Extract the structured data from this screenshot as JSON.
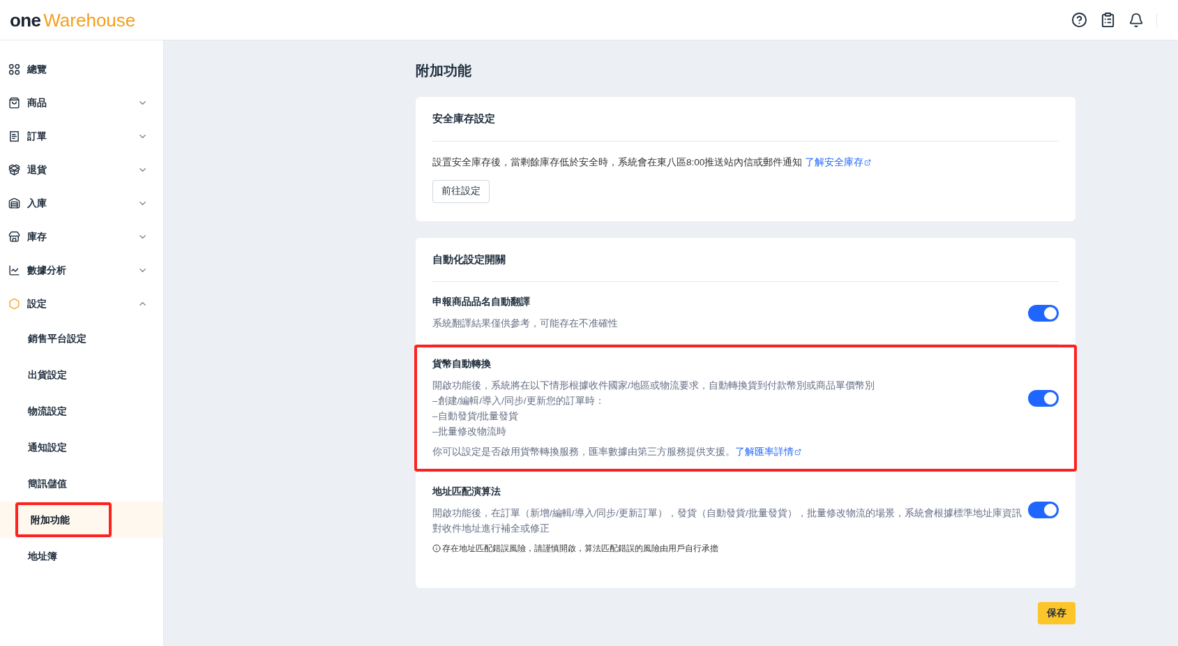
{
  "header": {
    "logo_main": "one",
    "logo_accent": "Warehouse"
  },
  "sidebar": {
    "items": [
      {
        "label": "總覽",
        "kind": "overview",
        "selected": false
      },
      {
        "label": "商品",
        "kind": "bag",
        "selected": false,
        "expanded": false
      },
      {
        "label": "訂單",
        "kind": "receipt",
        "selected": false,
        "expanded": false
      },
      {
        "label": "退貨",
        "kind": "return",
        "selected": false,
        "expanded": false
      },
      {
        "label": "入庫",
        "kind": "inbound",
        "selected": false,
        "expanded": false
      },
      {
        "label": "庫存",
        "kind": "store",
        "selected": false,
        "expanded": false
      },
      {
        "label": "數據分析",
        "kind": "chart",
        "selected": false,
        "expanded": false
      },
      {
        "label": "設定",
        "kind": "settings",
        "selected": true,
        "expanded": true,
        "children": [
          {
            "label": "銷售平台設定",
            "selected": false,
            "highlighted": false
          },
          {
            "label": "出貨設定",
            "selected": false,
            "highlighted": false
          },
          {
            "label": "物流設定",
            "selected": false,
            "highlighted": false
          },
          {
            "label": "通知設定",
            "selected": false,
            "highlighted": false
          },
          {
            "label": "簡訊儲值",
            "selected": false,
            "highlighted": false
          },
          {
            "label": "附加功能",
            "selected": true,
            "highlighted": true
          },
          {
            "label": "地址簿",
            "selected": false,
            "highlighted": false
          }
        ]
      }
    ]
  },
  "page": {
    "title": "附加功能",
    "safety_stock": {
      "title": "安全庫存設定",
      "description": "設置安全庫存後，當剩餘庫存低於安全時，系統會在東八區8:00推送站內信或郵件通知",
      "link": "了解安全庫存",
      "button": "前往設定"
    },
    "automation": {
      "title": "自動化設定開關",
      "settings": [
        {
          "title": "申報商品品名自動翻譯",
          "lines": [
            "系統翻譯結果僅供參考，可能存在不准確性"
          ],
          "on": true,
          "highlighted": false
        },
        {
          "title": "貨幣自動轉換",
          "lines": [
            "開啟功能後，系統將在以下情形根據收件國家/地區或物流要求，自動轉換貨到付款幣別或商品單價幣別",
            "–創建/編輯/導入/同步/更新您的訂單時：",
            "–自動發貨/批量發貨",
            "–批量修改物流時"
          ],
          "footer": "你可以設定是否啟用貨幣轉換服務，匯率數據由第三方服務提供支援。",
          "link": "了解匯率詳情",
          "on": true,
          "highlighted": true
        },
        {
          "title": "地址匹配演算法",
          "lines": [
            "開啟功能後，在訂單（新增/編輯/導入/同步/更新訂單），發貨（自動發貨/批量發貨），批量修改物流的場景，系統會根據標準地址庫資訊對收件地址進行補全或修正"
          ],
          "note": "存在地址匹配錯誤風險，請謹慎開啟，算法匹配錯誤的風險由用戶自行承擔",
          "on": true,
          "highlighted": false
        }
      ]
    },
    "save_button": "保存"
  }
}
